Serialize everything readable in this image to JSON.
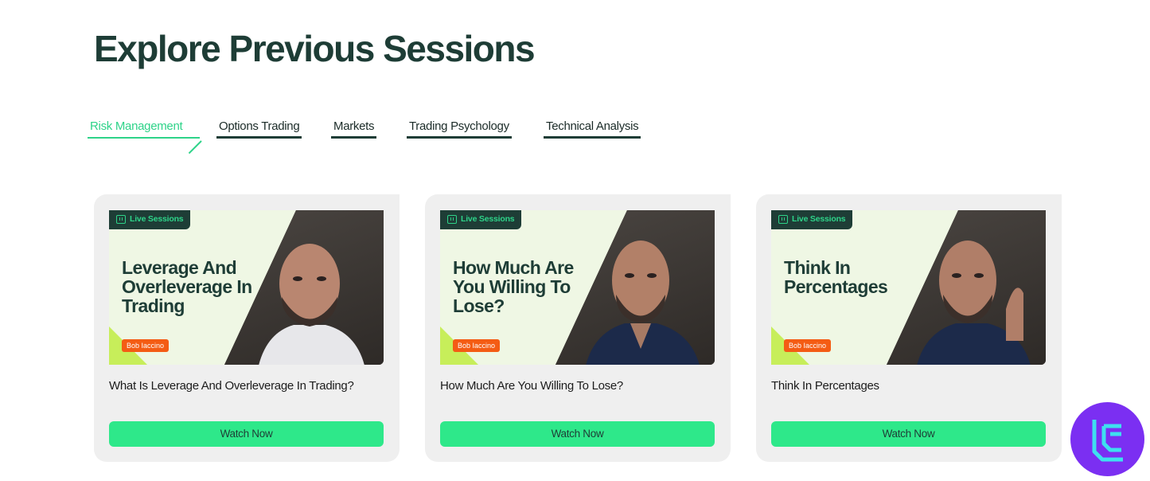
{
  "page_title": "Explore Previous Sessions",
  "tabs": [
    {
      "label": "Risk Management",
      "active": true
    },
    {
      "label": "Options Trading",
      "active": false
    },
    {
      "label": "Markets",
      "active": false
    },
    {
      "label": "Trading Psychology",
      "active": false
    },
    {
      "label": "Technical Analysis",
      "active": false
    }
  ],
  "cards": [
    {
      "badge": "Live Sessions",
      "thumb_title": "Leverage And Overleverage In Trading",
      "presenter": "Bob Iaccino",
      "caption": "What Is Leverage And Overleverage In Trading?",
      "button": "Watch Now"
    },
    {
      "badge": "Live Sessions",
      "thumb_title": "How Much Are You Willing To Lose?",
      "presenter": "Bob Iaccino",
      "caption": "How Much Are You Willing To Lose?",
      "button": "Watch Now"
    },
    {
      "badge": "Live Sessions",
      "thumb_title": "Think In Percentages",
      "presenter": "Bob Iaccino",
      "caption": "Think In Percentages",
      "button": "Watch Now"
    }
  ],
  "colors": {
    "accent": "#2ed389",
    "button": "#2ee88a",
    "dark": "#1e3d36",
    "presenter_tag": "#f45c14",
    "logo_bg": "#7b2ff2"
  }
}
